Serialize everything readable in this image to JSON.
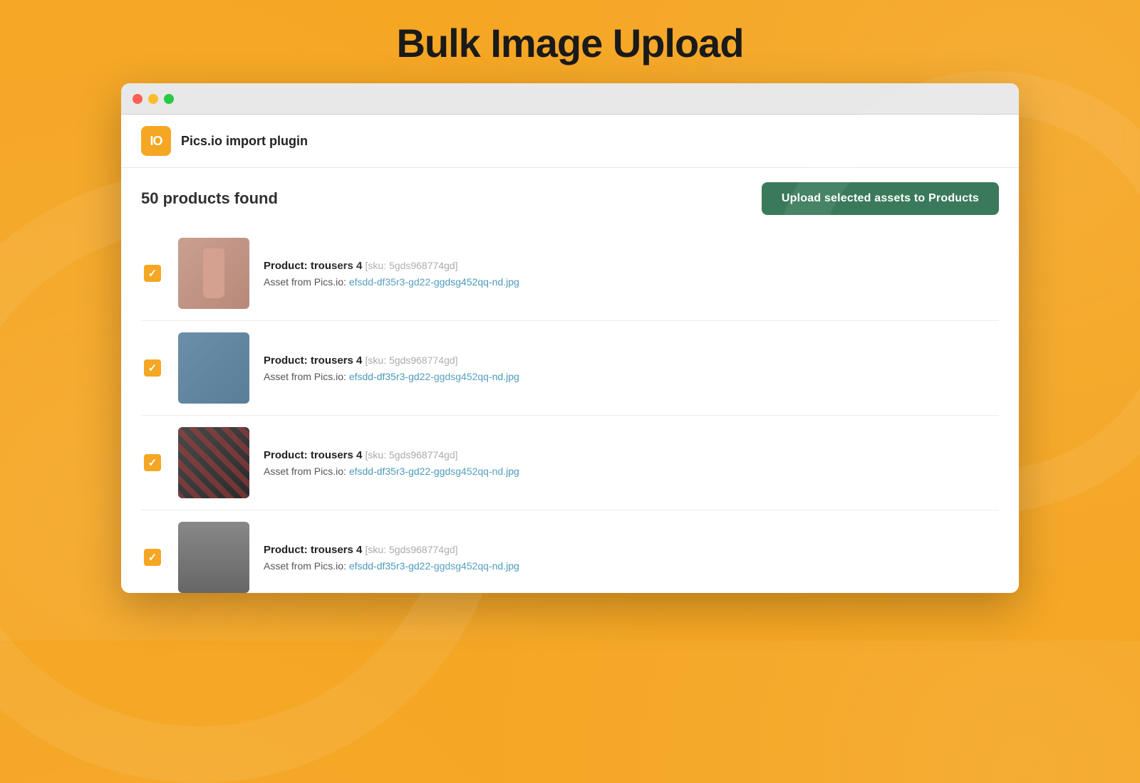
{
  "page": {
    "title": "Bulk Image Upload",
    "background_color": "#F5A623"
  },
  "titlebar": {
    "dots": [
      "red",
      "yellow",
      "green"
    ]
  },
  "header": {
    "logo_text": "IO",
    "plugin_title": "Pics.io import plugin"
  },
  "toolbar": {
    "products_found_label": "50 products found",
    "upload_button_label": "Upload selected assets to Products"
  },
  "products": [
    {
      "id": 1,
      "checked": true,
      "name": "Product: trousers 4",
      "sku": "[sku: 5gds968774gd]",
      "asset_prefix": "Asset from Pics.io:",
      "asset_link": "efsdd-df35r3-gd22-ggdsg452qq-nd.jpg",
      "thumb_class": "thumb-1"
    },
    {
      "id": 2,
      "checked": true,
      "name": "Product: trousers 4",
      "sku": "[sku: 5gds968774gd]",
      "asset_prefix": "Asset from Pics.io:",
      "asset_link": "efsdd-df35r3-gd22-ggdsg452qq-nd.jpg",
      "thumb_class": "thumb-2"
    },
    {
      "id": 3,
      "checked": true,
      "name": "Product: trousers 4",
      "sku": "[sku: 5gds968774gd]",
      "asset_prefix": "Asset from Pics.io:",
      "asset_link": "efsdd-df35r3-gd22-ggdsg452qq-nd.jpg",
      "thumb_class": "thumb-3"
    },
    {
      "id": 4,
      "checked": true,
      "name": "Product: trousers 4",
      "sku": "[sku: 5gds968774gd]",
      "asset_prefix": "Asset from Pics.io:",
      "asset_link": "efsdd-df35r3-gd22-ggdsg452qq-nd.jpg",
      "thumb_class": "thumb-4"
    }
  ]
}
